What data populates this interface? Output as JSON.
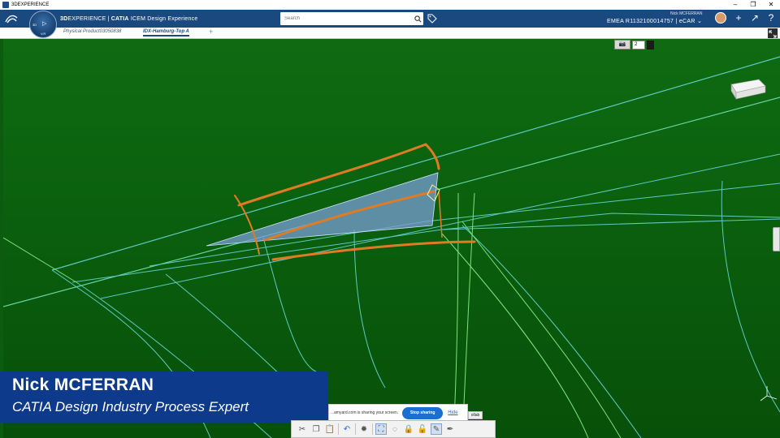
{
  "window": {
    "title": "3DEXPERIENCE",
    "controls": [
      "–",
      "❐",
      "✕"
    ]
  },
  "topbar": {
    "brand_3d": "3D",
    "brand_rest": "EXPERIENCE | ",
    "brand_app": "CATIA",
    "brand_tail": " ICEM Design Experience",
    "search_placeholder": "Search",
    "user_name": "Nick MCFERRAN",
    "tenant": "EMEA R1132100014757 | eCAR ⌄",
    "actions": [
      "+",
      "↗",
      "?"
    ]
  },
  "compass": {
    "left": "3D",
    "right": "▷",
    "bottom": "V,R"
  },
  "tabs": [
    {
      "label": "Physical Product03050838",
      "active": false
    },
    {
      "label": "IDX-Hamburg-Top A",
      "active": true
    }
  ],
  "tab_add": "+",
  "view_toolbar": {
    "camera": "📷",
    "value": "2"
  },
  "presenter": {
    "name": "Nick MCFERRAN",
    "role": "CATIA Design Industry Process Expert"
  },
  "share_bar": {
    "message": "…amyard.com is sharing your screen.",
    "stop_label": "Stop sharing",
    "hide_label": "Hide",
    "collab_tab": "ollab"
  },
  "action_bar": {
    "icons": [
      "scissors-icon",
      "copy-icon",
      "paste-icon",
      "undo-icon",
      "settings-icon",
      "select-icon",
      "lasso-icon",
      "lock-icon",
      "unlock-icon",
      "pencil-icon",
      "pen-icon"
    ]
  },
  "colors": {
    "viewport_bg": "#0b5c0f",
    "curve_orange": "#e07b25",
    "wire_cyan": "#6fd3c8",
    "wire_green": "#7ee07e",
    "surface_blue": "#7a9dd6",
    "topbar_bg": "#1a4980",
    "lower_third_bg": "#0d3a8a"
  }
}
